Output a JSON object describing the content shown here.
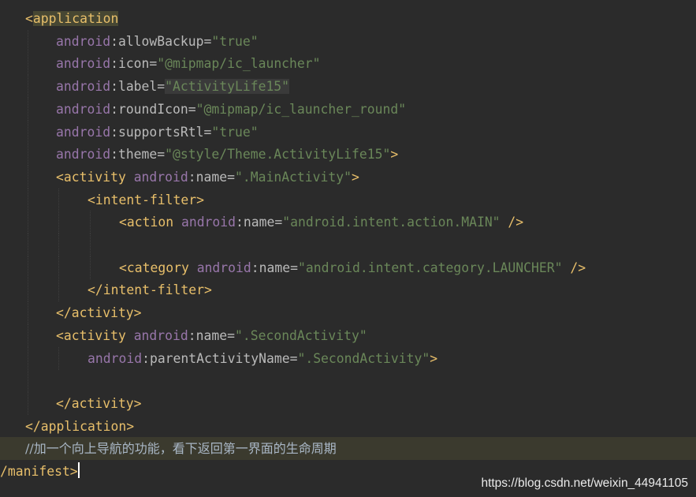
{
  "editor": {
    "lines": [
      [
        {
          "t": "<",
          "c": "tag"
        },
        {
          "t": "application",
          "c": "tag match"
        }
      ],
      [
        {
          "t": "android",
          "c": "ns"
        },
        {
          "t": ":allowBackup=",
          "c": "attr"
        },
        {
          "t": "\"true\"",
          "c": "val"
        }
      ],
      [
        {
          "t": "android",
          "c": "ns"
        },
        {
          "t": ":icon=",
          "c": "attr"
        },
        {
          "t": "\"@mipmap/ic_launcher\"",
          "c": "val"
        }
      ],
      [
        {
          "t": "android",
          "c": "ns"
        },
        {
          "t": ":label=",
          "c": "attr"
        },
        {
          "t": "\"ActivityLife15\"",
          "c": "val sel"
        }
      ],
      [
        {
          "t": "android",
          "c": "ns"
        },
        {
          "t": ":roundIcon=",
          "c": "attr"
        },
        {
          "t": "\"@mipmap/ic_launcher_round\"",
          "c": "val"
        }
      ],
      [
        {
          "t": "android",
          "c": "ns"
        },
        {
          "t": ":supportsRtl=",
          "c": "attr"
        },
        {
          "t": "\"true\"",
          "c": "val"
        }
      ],
      [
        {
          "t": "android",
          "c": "ns"
        },
        {
          "t": ":theme=",
          "c": "attr"
        },
        {
          "t": "\"@style/Theme.ActivityLife15\"",
          "c": "val"
        },
        {
          "t": ">",
          "c": "tag"
        }
      ],
      [
        {
          "t": "<activity ",
          "c": "tag"
        },
        {
          "t": "android",
          "c": "ns"
        },
        {
          "t": ":name=",
          "c": "attr"
        },
        {
          "t": "\".MainActivity\"",
          "c": "val"
        },
        {
          "t": ">",
          "c": "tag"
        }
      ],
      [
        {
          "t": "<intent-filter>",
          "c": "tag"
        }
      ],
      [
        {
          "t": "<action ",
          "c": "tag"
        },
        {
          "t": "android",
          "c": "ns"
        },
        {
          "t": ":name=",
          "c": "attr"
        },
        {
          "t": "\"android.intent.action.MAIN\"",
          "c": "val"
        },
        {
          "t": " />",
          "c": "tag"
        }
      ],
      [],
      [
        {
          "t": "<category ",
          "c": "tag"
        },
        {
          "t": "android",
          "c": "ns"
        },
        {
          "t": ":name=",
          "c": "attr"
        },
        {
          "t": "\"android.intent.category.LAUNCHER\"",
          "c": "val"
        },
        {
          "t": " />",
          "c": "tag"
        }
      ],
      [
        {
          "t": "</intent-filter>",
          "c": "tag"
        }
      ],
      [
        {
          "t": "</activity>",
          "c": "tag"
        }
      ],
      [
        {
          "t": "<activity ",
          "c": "tag"
        },
        {
          "t": "android",
          "c": "ns"
        },
        {
          "t": ":name=",
          "c": "attr"
        },
        {
          "t": "\".SecondActivity\"",
          "c": "val"
        }
      ],
      [
        {
          "t": "android",
          "c": "ns"
        },
        {
          "t": ":parentActivityName=",
          "c": "attr"
        },
        {
          "t": "\".SecondActivity\"",
          "c": "val"
        },
        {
          "t": ">",
          "c": "tag"
        }
      ],
      [],
      [
        {
          "t": "</activity>",
          "c": "tag"
        }
      ],
      [
        {
          "t": "</application>",
          "c": "tag"
        }
      ],
      [
        {
          "t": "//加一个向上导航的功能，看下返回第一界面的生命周期",
          "c": "comment"
        }
      ],
      [
        {
          "t": "/manifest>",
          "c": "tag"
        },
        {
          "t": "",
          "c": "caret"
        }
      ]
    ]
  },
  "watermark": "https://blog.csdn.net/weixin_44941105",
  "colors": {
    "background": "#2b2b2b",
    "tag": "#e8bf6a",
    "namespace": "#9876aa",
    "attribute": "#bababa",
    "value": "#6a8759",
    "highlight_line": "#3b3a2e"
  }
}
